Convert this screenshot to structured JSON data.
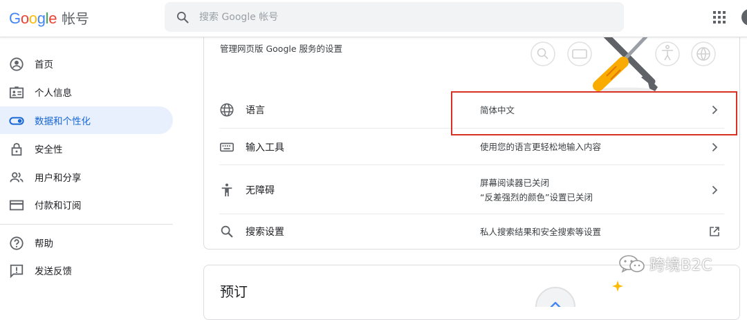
{
  "header": {
    "logo_letters": [
      "G",
      "o",
      "o",
      "g",
      "l",
      "e"
    ],
    "account_label": "帐号",
    "search_placeholder": "搜索 Google 帐号",
    "apps_icon": "apps-grid-icon"
  },
  "sidebar": {
    "items": [
      {
        "label": "首页",
        "icon": "account-circle-icon",
        "active": false
      },
      {
        "label": "个人信息",
        "icon": "id-card-icon",
        "active": false
      },
      {
        "label": "数据和个性化",
        "icon": "toggle-icon",
        "active": true
      },
      {
        "label": "安全性",
        "icon": "lock-icon",
        "active": false
      },
      {
        "label": "用户和分享",
        "icon": "people-icon",
        "active": false
      },
      {
        "label": "付款和订阅",
        "icon": "credit-card-icon",
        "active": false
      },
      {
        "label": "帮助",
        "icon": "help-icon",
        "active": false
      },
      {
        "label": "发送反馈",
        "icon": "feedback-icon",
        "active": false
      }
    ]
  },
  "web_prefs": {
    "description": "管理网页版 Google 服务的设置",
    "rows": [
      {
        "label": "语言",
        "icon": "globe-icon",
        "value_line1": "简体中文",
        "value_line2": "",
        "action_icon": "chevron-right-icon"
      },
      {
        "label": "输入工具",
        "icon": "keyboard-icon",
        "value_line1": "使用您的语言更轻松地输入内容",
        "value_line2": "",
        "action_icon": "chevron-right-icon"
      },
      {
        "label": "无障碍",
        "icon": "accessibility-icon",
        "value_line1": "屏幕阅读器已关闭",
        "value_line2": "“反差强烈的颜色”设置已关闭",
        "action_icon": "chevron-right-icon"
      },
      {
        "label": "搜索设置",
        "icon": "search-icon",
        "value_line1": "私人搜索结果和安全搜索等设置",
        "value_line2": "",
        "action_icon": "open-external-icon"
      }
    ]
  },
  "reservations": {
    "title": "预订"
  },
  "watermark": {
    "text": "跨境B2C",
    "icon": "wechat-icon"
  },
  "colors": {
    "accent": "#1967d2",
    "active_bg": "#e8f0fe",
    "highlight": "#d93025",
    "tools_yellow": "#f9ab00",
    "tools_gray": "#5f6368"
  }
}
